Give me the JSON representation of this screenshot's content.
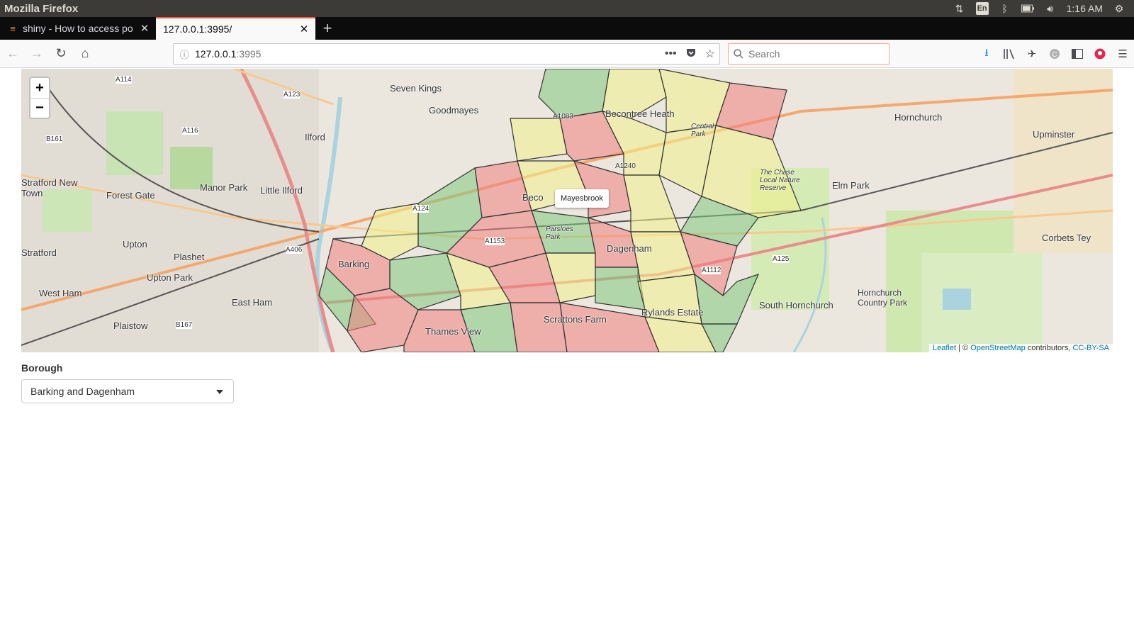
{
  "os": {
    "title": "Mozilla Firefox",
    "lang": "En",
    "clock": "1:16 AM"
  },
  "tabs": [
    {
      "label": "shiny - How to access po",
      "active": false
    },
    {
      "label": "127.0.0.1:3995/",
      "active": true
    }
  ],
  "nav": {
    "url_host": "127.0.0.1",
    "url_port": ":3995",
    "search_placeholder": "Search"
  },
  "map": {
    "zoom_in": "+",
    "zoom_out": "−",
    "tooltip": "Mayesbrook",
    "attribution": {
      "leaflet": "Leaflet",
      "sep": " | © ",
      "osm": "OpenStreetMap",
      "contrib": " contributors, ",
      "license": "CC-BY-SA"
    },
    "place_labels": [
      "Seven Kings",
      "Goodmayes",
      "Ilford",
      "Becontree Heath",
      "Hornchurch",
      "Upminster",
      "Forest Gate",
      "Manor Park",
      "Little Ilford",
      "Elm Park",
      "Upton",
      "Plashet",
      "Upton Park",
      "Barking",
      "Dagenham",
      "West Ham",
      "East Ham",
      "Plaistow",
      "Scrattons Farm",
      "Rylands Estate",
      "South Hornchurch",
      "Hornchurch Country Park",
      "Corbets Tey",
      "Thames View",
      "Stratford New Town",
      "Stratford",
      "The Chase Local Nature Reserve",
      "Parsloes Park",
      "Central Park",
      "Beco"
    ],
    "road_labels": [
      "A114",
      "A123",
      "A116",
      "B161",
      "A124",
      "A406",
      "A1153",
      "A125",
      "A1112",
      "B167",
      "A1083",
      "A1240"
    ]
  },
  "controls": {
    "borough_label": "Borough",
    "borough_value": "Barking and Dagenham"
  },
  "colors": {
    "red": "#f08080",
    "yellow": "#f0f08a",
    "green": "#7fc87f",
    "tab_accent": "#ff5b3a"
  }
}
